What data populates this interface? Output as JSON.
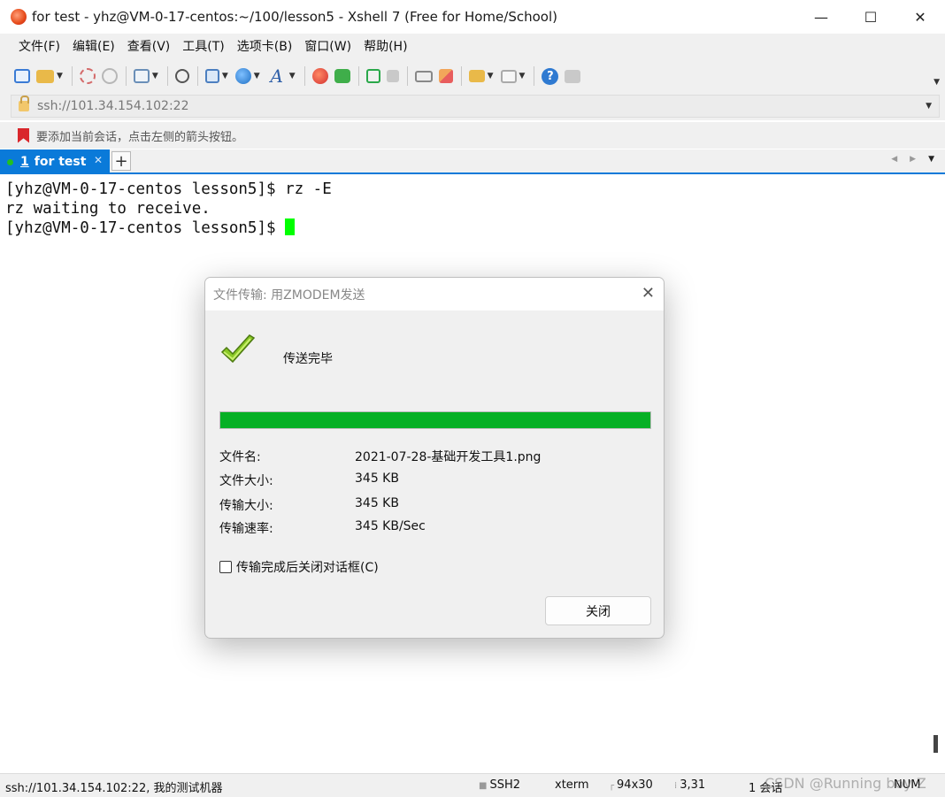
{
  "window": {
    "title": "for test - yhz@VM-0-17-centos:~/100/lesson5 - Xshell 7 (Free for Home/School)",
    "minimize": "—",
    "maximize": "☐",
    "close": "✕"
  },
  "menu": {
    "items": [
      "文件(F)",
      "编辑(E)",
      "查看(V)",
      "工具(T)",
      "选项卡(B)",
      "窗口(W)",
      "帮助(H)"
    ]
  },
  "toolbar": {
    "icons": [
      "new-session-icon",
      "open-folder-icon",
      "reconnect-icon",
      "disconnect-icon",
      "properties-icon",
      "search-icon",
      "transfer-icon",
      "globe-icon",
      "font-icon",
      "xshell-icon",
      "xftp-icon",
      "fullscreen-icon",
      "lock-icon",
      "keyboard-icon",
      "highlight-icon",
      "new-tab-icon",
      "layout-icon",
      "help-icon",
      "chat-icon"
    ],
    "help_glyph": "?",
    "font_glyph": "A"
  },
  "address": {
    "value": "ssh://101.34.154.102:22"
  },
  "hint": {
    "text": "要添加当前会话，点击左侧的箭头按钮。"
  },
  "tabs": {
    "active": {
      "number": "1",
      "label": "for test",
      "close": "✕"
    },
    "add": "+",
    "accent_color": "#0a7ad9"
  },
  "terminal": {
    "lines": [
      "[yhz@VM-0-17-centos lesson5]$ rz -E",
      "rz waiting to receive.",
      "[yhz@VM-0-17-centos lesson5]$ "
    ],
    "cursor_color": "#00ff00"
  },
  "dialog": {
    "title": "文件传输: 用ZMODEM发送",
    "close": "✕",
    "status": "传送完毕",
    "progress": 1.0,
    "progress_color": "#06b025",
    "rows": [
      {
        "label": "文件名:",
        "value": "2021-07-28-基础开发工具1.png"
      },
      {
        "label": "文件大小:",
        "value": "345 KB"
      },
      {
        "label": "传输大小:",
        "value": "345 KB"
      },
      {
        "label": "传输速率:",
        "value": "345 KB/Sec"
      }
    ],
    "checkbox_label": "传输完成后关闭对话框(C)",
    "checkbox_checked": false,
    "close_button": "关闭"
  },
  "statusbar": {
    "session": "ssh://101.34.154.102:22, 我的测试机器",
    "protocol": "SSH2",
    "term_type": "xterm",
    "size": "94x30",
    "cursor_pos": "3,31",
    "sessions": "1 会话",
    "num": "NUM",
    "watermark": "CSDN @Running boy Z"
  }
}
